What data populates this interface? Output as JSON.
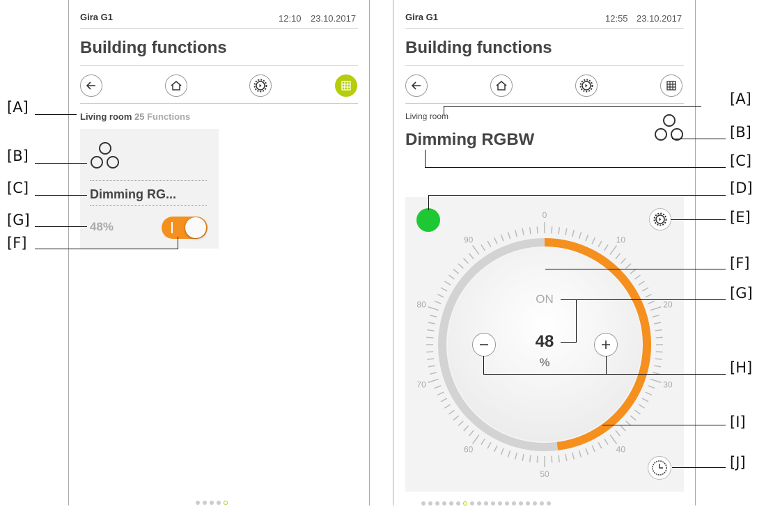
{
  "left": {
    "device_name": "Gira G1",
    "time": "12:10",
    "date": "23.10.2017",
    "title": "Building functions",
    "room": "Living room",
    "count": "25",
    "count_suffix": "Functions",
    "tile_label": "Dimming RG...",
    "tile_value": "48%",
    "page_dots": 5,
    "active_dot": 4,
    "nav_icons": [
      "back-arrow-icon",
      "home-icon",
      "gear-icon",
      "grid-icon"
    ]
  },
  "right": {
    "device_name": "Gira G1",
    "time": "12:55",
    "date": "23.10.2017",
    "title": "Building functions",
    "room": "Living room",
    "function_name": "Dimming RGBW",
    "status": "ON",
    "value": "48",
    "unit": "%",
    "dial_labels": [
      "0",
      "10",
      "20",
      "30",
      "40",
      "50",
      "60",
      "70",
      "80",
      "90"
    ],
    "level_fraction": 0.48,
    "page_dots": 19,
    "active_dot": 6,
    "colors": {
      "accent": "#f5901e",
      "green": "#1ec832",
      "lime": "#b5cd0c"
    }
  },
  "callouts": {
    "left": [
      "[A]",
      "[B]",
      "[C]",
      "[G]",
      "[F]"
    ],
    "right": [
      "[A]",
      "[B]",
      "[C]",
      "[D]",
      "[E]",
      "[F]",
      "[G]",
      "[H]",
      "[I]",
      "[J]"
    ]
  }
}
